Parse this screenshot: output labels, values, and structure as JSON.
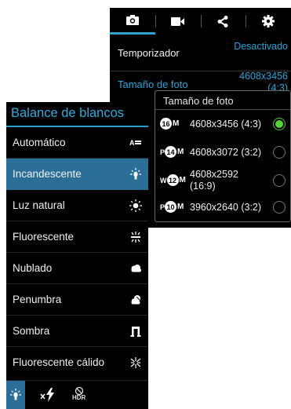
{
  "camera_settings": {
    "tabs": [
      {
        "icon": "camera-icon"
      },
      {
        "icon": "video-camera-icon"
      },
      {
        "icon": "share-icon"
      },
      {
        "icon": "gear-icon"
      }
    ],
    "rows": [
      {
        "label": "Temporizador",
        "value": "Desactivado"
      },
      {
        "label": "Tamaño de foto",
        "value": "4608x3456 (4:3)"
      }
    ]
  },
  "photo_size_popup": {
    "title": "Tamaño de foto",
    "options": [
      {
        "prefix": "",
        "megapixels": "16",
        "suffix": "M",
        "label": "4608x3456 (4:3)",
        "selected": true
      },
      {
        "prefix": "P",
        "megapixels": "14",
        "suffix": "M",
        "label": "4608x3072 (3:2)",
        "selected": false
      },
      {
        "prefix": "W",
        "megapixels": "12",
        "suffix": "M",
        "label": "4608x2592 (16:9)",
        "selected": false
      },
      {
        "prefix": "P",
        "megapixels": "10",
        "suffix": "M",
        "label": "3960x2640 (3:2)",
        "selected": false
      }
    ]
  },
  "white_balance": {
    "title": "Balance de blancos",
    "items": [
      {
        "label": "Automático",
        "icon": "auto-wb-icon",
        "selected": false
      },
      {
        "label": "Incandescente",
        "icon": "incandescent-icon",
        "selected": true
      },
      {
        "label": "Luz natural",
        "icon": "sun-icon",
        "selected": false
      },
      {
        "label": "Fluorescente",
        "icon": "fluorescent-icon",
        "selected": false
      },
      {
        "label": "Nublado",
        "icon": "cloud-icon",
        "selected": false
      },
      {
        "label": "Penumbra",
        "icon": "dusk-icon",
        "selected": false
      },
      {
        "label": "Sombra",
        "icon": "shade-icon",
        "selected": false
      },
      {
        "label": "Fluorescente cálido",
        "icon": "warm-fluorescent-icon",
        "selected": false
      }
    ],
    "bottom_bar": {
      "icons": [
        "incandescent-icon",
        "flash-off-icon",
        "hdr-off-icon"
      ],
      "hdr_label": "HDR"
    }
  },
  "colors": {
    "accent": "#2aa3d5",
    "selected_bg": "#2b6f99",
    "radio_checked": "#56d33f"
  }
}
